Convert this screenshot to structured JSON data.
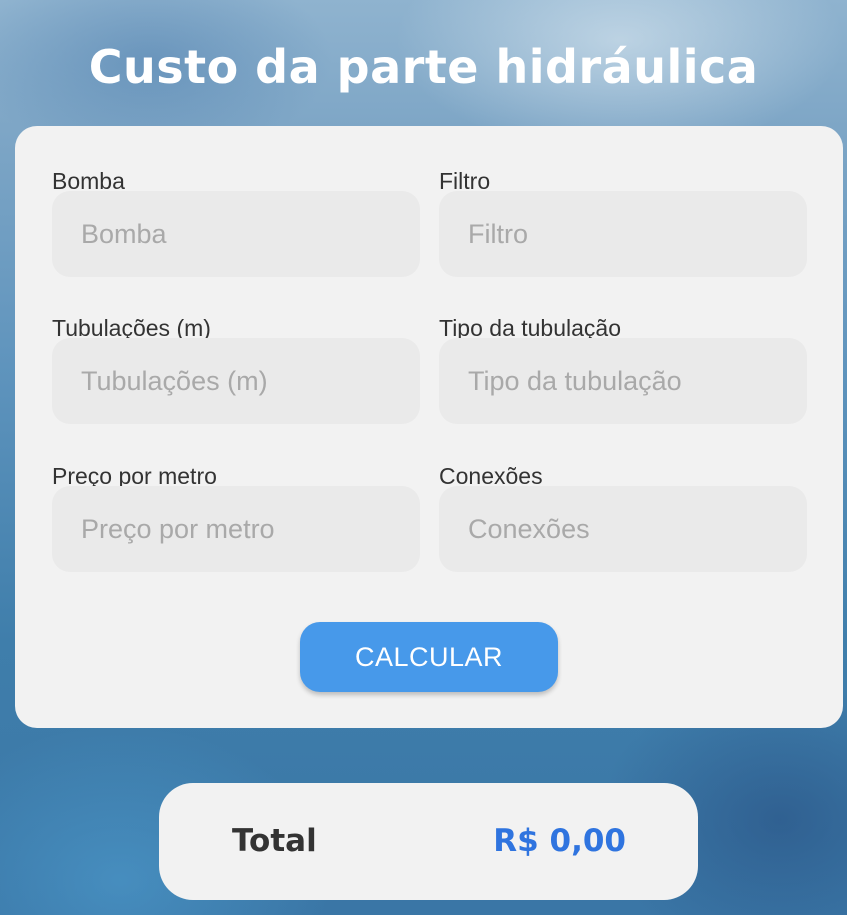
{
  "page": {
    "title": "Custo da parte hidráulica"
  },
  "form": {
    "fields": [
      {
        "label": "Bomba",
        "placeholder": "Bomba",
        "value": ""
      },
      {
        "label": "Filtro",
        "placeholder": "Filtro",
        "value": ""
      },
      {
        "label": "Tubulações (m)",
        "placeholder": "Tubulações (m)",
        "value": ""
      },
      {
        "label": "Tipo da tubulação",
        "placeholder": "Tipo da tubulação",
        "value": ""
      },
      {
        "label": "Preço por metro",
        "placeholder": "Preço por metro",
        "value": ""
      },
      {
        "label": "Conexões",
        "placeholder": "Conexões",
        "value": ""
      }
    ],
    "calculate_label": "CALCULAR"
  },
  "result": {
    "label": "Total",
    "value": "R$ 0,00"
  },
  "colors": {
    "accent": "#4799ea",
    "total_value": "#2f74df",
    "card_bg": "#f2f2f2",
    "input_bg": "#eaeaea"
  }
}
